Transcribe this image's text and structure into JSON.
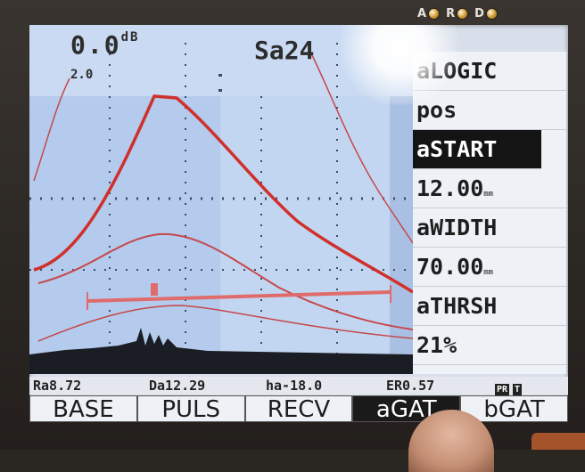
{
  "device": {
    "indicators": [
      {
        "label": "A",
        "icon": "led-icon"
      },
      {
        "label": "R",
        "icon": "led-icon"
      },
      {
        "label": "D",
        "icon": "led-icon"
      }
    ]
  },
  "screen": {
    "gain": {
      "value": "0.0",
      "unit": "dB",
      "step": "2.0"
    },
    "mode": "Sa24"
  },
  "params": [
    {
      "label": "aLOGIC"
    },
    {
      "label": "pos"
    },
    {
      "label": "aSTART",
      "selected": true
    },
    {
      "label": "12.00",
      "unit": "mm"
    },
    {
      "label": "aWIDTH"
    },
    {
      "label": "70.00",
      "unit": "mm"
    },
    {
      "label": "aTHRSH"
    },
    {
      "label": "21%"
    }
  ],
  "status": {
    "ra": "Ra8.72",
    "da": "Da12.29",
    "ha": "ha-18.0",
    "er": "ER0.57",
    "flags": [
      "PR",
      "T"
    ]
  },
  "menu": [
    {
      "label": "BASE",
      "active": false
    },
    {
      "label": "PULS",
      "active": false
    },
    {
      "label": "RECV",
      "active": false
    },
    {
      "label": "aGAT",
      "active": true
    },
    {
      "label": "bGAT",
      "active": false
    }
  ],
  "colors": {
    "trace": "#d0302c",
    "screen_bg": "#b9cfee",
    "panel_bg": "#eef1f6"
  }
}
